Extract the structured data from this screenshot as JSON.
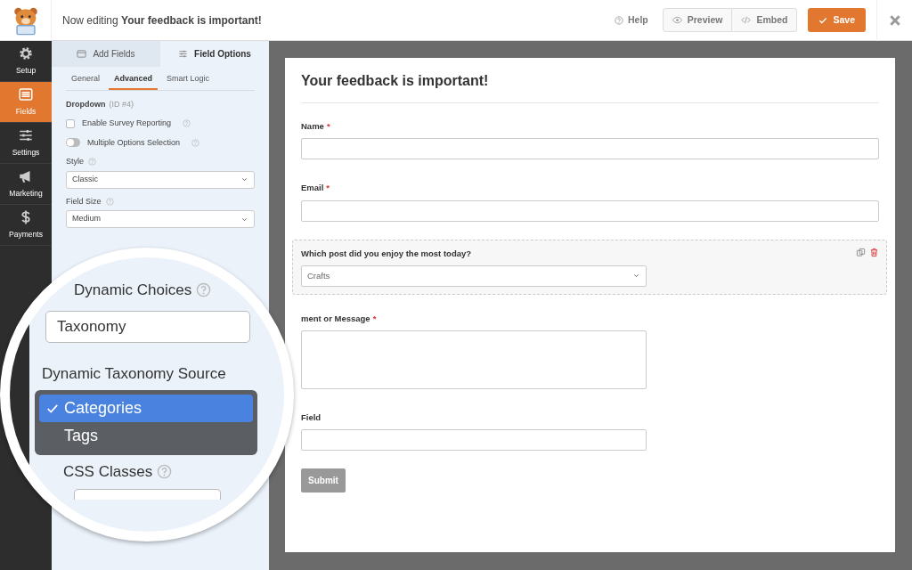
{
  "header": {
    "title_prefix": "Now editing",
    "title": "Your feedback is important!",
    "help": "Help",
    "buttons": [
      {
        "label": "Preview",
        "kind": "preview"
      },
      {
        "label": "Embed",
        "kind": "embed"
      }
    ],
    "save": "Save"
  },
  "sidebar": {
    "items": [
      {
        "label": "Setup",
        "kind": "gear",
        "selected": false
      },
      {
        "label": "Fields",
        "kind": "list",
        "selected": true
      },
      {
        "label": "Settings",
        "kind": "sliders",
        "selected": false
      },
      {
        "label": "Marketing",
        "kind": "megaphone",
        "selected": false
      },
      {
        "label": "Payments",
        "kind": "dollar",
        "selected": false
      }
    ]
  },
  "panel": {
    "tabs": [
      {
        "label": "Add Fields",
        "kind": "add",
        "selected": false
      },
      {
        "label": "Field Options",
        "kind": "options",
        "selected": true
      }
    ],
    "subtabs": [
      {
        "label": "General",
        "selected": false
      },
      {
        "label": "Advanced",
        "selected": true
      },
      {
        "label": "Smart Logic",
        "selected": false
      }
    ],
    "field_type": "Dropdown",
    "field_id": "(ID #4)",
    "options": [
      {
        "kind": "checkbox",
        "label": "Enable Survey Reporting",
        "checked": false
      },
      {
        "kind": "toggle",
        "label": "Multiple Options Selection",
        "on": false
      }
    ],
    "selects": [
      {
        "label": "Style",
        "value": "Classic"
      },
      {
        "label": "Field Size",
        "value": "Medium"
      }
    ]
  },
  "magnifier": {
    "choices_label": "Dynamic Choices",
    "choices_value": "Taxonomy",
    "source_label": "Dynamic Taxonomy Source",
    "source_options": [
      {
        "label": "Categories",
        "selected": true
      },
      {
        "label": "Tags",
        "selected": false
      }
    ],
    "css_label": "CSS Classes"
  },
  "form": {
    "title": "Your feedback is important!",
    "fields": [
      {
        "kind": "input",
        "label": "Name",
        "required_mark": "*",
        "selected": false
      },
      {
        "kind": "input",
        "label": "Email",
        "required_mark": "*",
        "selected": false
      },
      {
        "kind": "select",
        "label": "Which post did you enjoy the most today?",
        "value": "Crafts",
        "selected": true
      },
      {
        "kind": "textarea",
        "label": "ment or Message",
        "required_mark": "*",
        "selected": false
      },
      {
        "kind": "input-short",
        "label": "Field",
        "selected": false
      }
    ],
    "submit": "Submit"
  }
}
